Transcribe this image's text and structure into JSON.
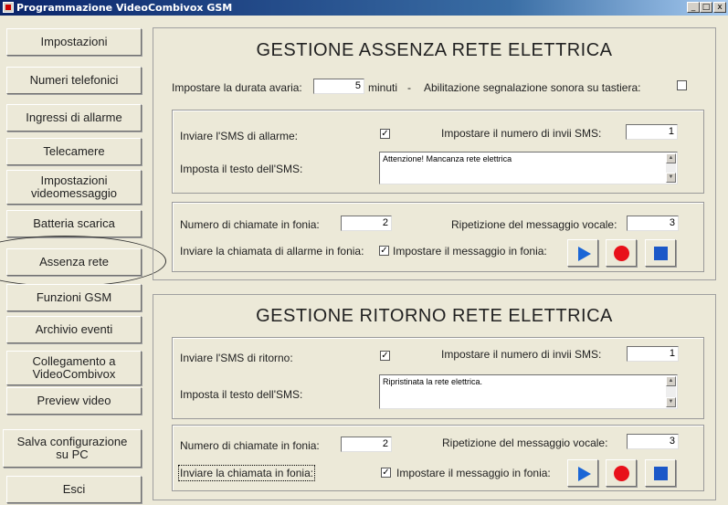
{
  "window": {
    "title": "Programmazione VideoCombivox GSM",
    "minimize_glyph": "_",
    "maximize_glyph": "□",
    "close_glyph": "x"
  },
  "nav": {
    "impostazioni": "Impostazioni",
    "numeri": "Numeri telefonici",
    "ingressi": "Ingressi di allarme",
    "telecamere": "Telecamere",
    "videomessaggio_l1": "Impostazioni",
    "videomessaggio_l2": "videomessaggio",
    "batteria": "Batteria scarica",
    "assenza": "Assenza rete",
    "gsm": "Funzioni GSM",
    "archivio": "Archivio eventi",
    "collegamento_l1": "Collegamento a",
    "collegamento_l2": "VideoCombivox",
    "preview": "Preview video",
    "salva_l1": "Salva configurazione",
    "salva_l2": "su PC",
    "esci": "Esci"
  },
  "assenza": {
    "title": "GESTIONE ASSENZA RETE ELETTRICA",
    "durata_label": "Impostare la durata avaria:",
    "durata_value": "5",
    "minuti": "minuti",
    "sep": "-",
    "sonora_label": "Abilitazione segnalazione sonora su tastiera:",
    "sonora_checked": "",
    "sms_label": "Inviare l'SMS di allarme:",
    "sms_checked": "✓",
    "invii_label": "Impostare il numero di invii SMS:",
    "invii_value": "1",
    "testo_label": "Imposta il testo dell'SMS:",
    "testo_value": "Attenzione! Mancanza rete elettrica",
    "chiamate_label": "Numero di chiamate in fonia:",
    "chiamate_value": "2",
    "ripetizione_label": "Ripetizione del messaggio vocale:",
    "ripetizione_value": "3",
    "inviare_chiamata_label": "Inviare la chiamata di allarme in fonia:",
    "inviare_chiamata_checked": "✓",
    "messaggio_label": "Impostare il messaggio in fonia:"
  },
  "ritorno": {
    "title": "GESTIONE RITORNO RETE ELETTRICA",
    "sms_label": "Inviare l'SMS di ritorno:",
    "sms_checked": "✓",
    "invii_label": "Impostare il numero di invii SMS:",
    "invii_value": "1",
    "testo_label": "Imposta il testo dell'SMS:",
    "testo_value": "Ripristinata la rete elettrica.",
    "chiamate_label": "Numero di chiamate in fonia:",
    "chiamate_value": "2",
    "ripetizione_label": "Ripetizione del messaggio vocale:",
    "ripetizione_value": "3",
    "inviare_chiamata_label": "Inviare la chiamata in fonia:",
    "messaggio_checked": "✓",
    "messaggio_label": "Impostare il messaggio in fonia:"
  },
  "colors": {
    "play": "#1b66d6",
    "record": "#e8101a",
    "stop": "#1b58c8"
  },
  "icons": {
    "play": "play-icon",
    "record": "record-icon",
    "stop": "stop-icon"
  }
}
